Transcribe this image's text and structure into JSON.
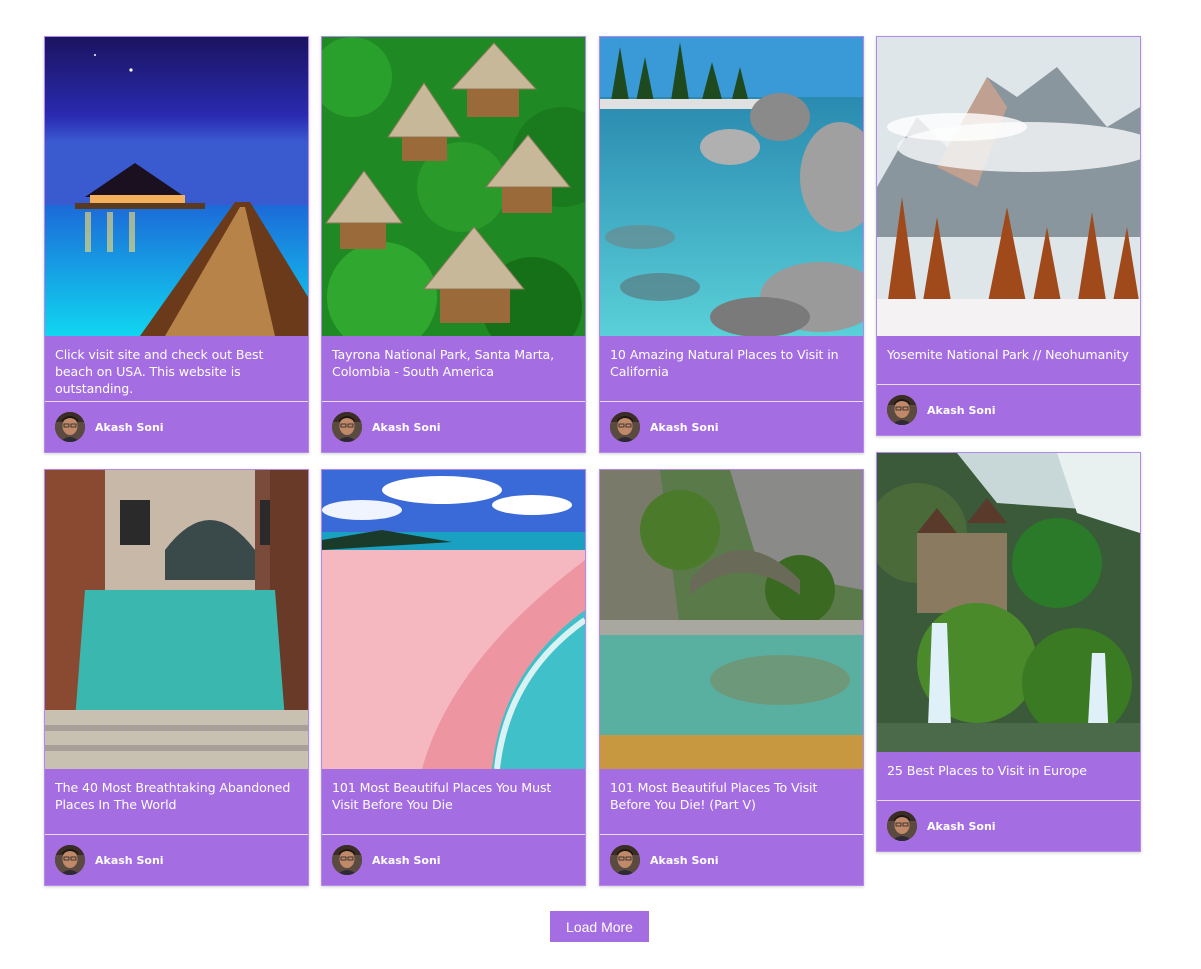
{
  "colors": {
    "accent": "#a56de2",
    "divider": "#e7dbf6",
    "text": "#ffffff"
  },
  "cards": [
    {
      "title": "Click visit site and check out Best beach on USA. This website is outstanding.",
      "author": "Akash Soni",
      "image": "overwater-villa-night"
    },
    {
      "title": "Tayrona National Park, Santa Marta, Colombia - South America",
      "author": "Akash Soni",
      "image": "jungle-thatched-huts"
    },
    {
      "title": "10 Amazing Natural Places to Visit in California",
      "author": "Akash Soni",
      "image": "lake-boulders"
    },
    {
      "title": "Yosemite National Park // Neohumanity",
      "author": "Akash Soni",
      "image": "snowy-mountain-autumn-trees"
    },
    {
      "title": "The 40 Most Breathtaking Abandoned Places In The World",
      "author": "Akash Soni",
      "image": "venice-canal-doorway"
    },
    {
      "title": "101 Most Beautiful Places You Must Visit Before You Die",
      "author": "Akash Soni",
      "image": "pink-sand-beach"
    },
    {
      "title": "101 Most Beautiful Places To Visit Before You Die! (Part V)",
      "author": "Akash Soni",
      "image": "stone-bridge-river"
    },
    {
      "title": "25 Best Places to Visit in Europe",
      "author": "Akash Soni",
      "image": "waterfall-castle"
    }
  ],
  "load_more_label": "Load More"
}
